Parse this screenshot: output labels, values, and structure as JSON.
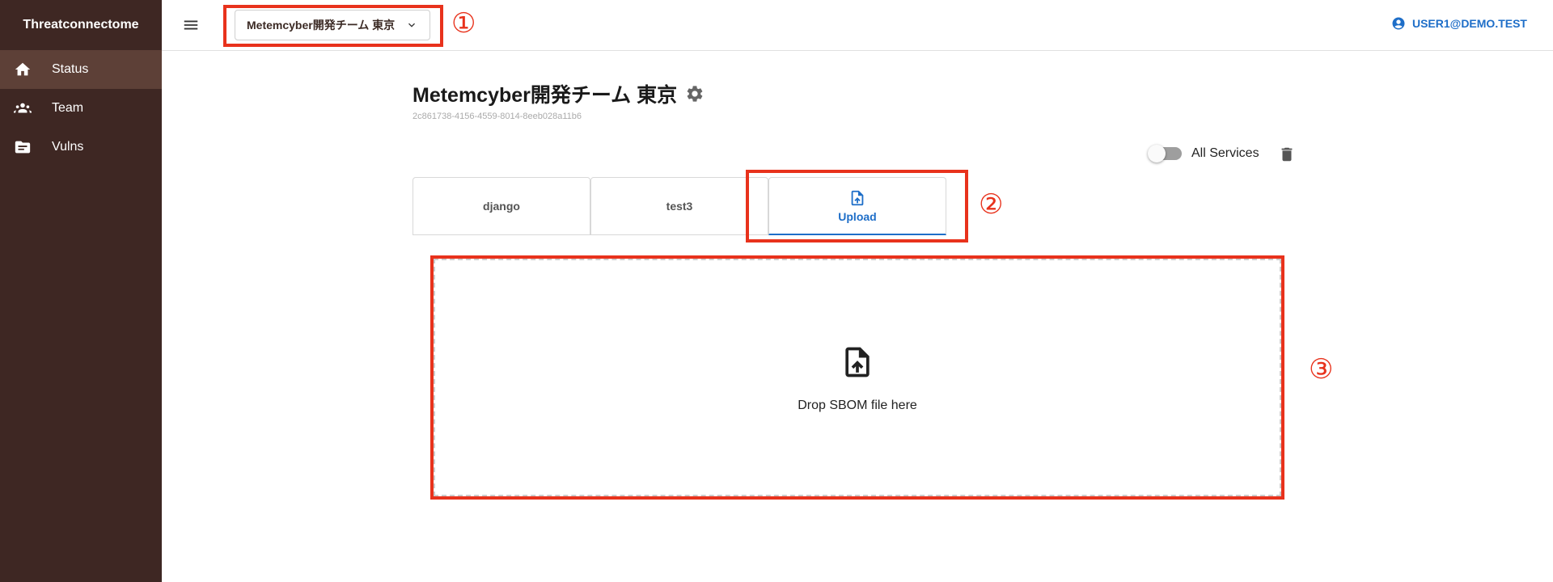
{
  "app": {
    "name": "Threatconnectome"
  },
  "sidebar": {
    "items": [
      {
        "label": "Status",
        "icon": "home-icon",
        "active": true
      },
      {
        "label": "Team",
        "icon": "groups-icon",
        "active": false
      },
      {
        "label": "Vulns",
        "icon": "topic-folder-icon",
        "active": false
      }
    ]
  },
  "header": {
    "team_selector": "Metemcyber開発チーム 東京",
    "user": "USER1@DEMO.TEST"
  },
  "main": {
    "title": "Metemcyber開発チーム 東京",
    "team_id": "2c861738-4156-4559-8014-8eeb028a11b6",
    "toggle_label": "All Services",
    "toggle_on": false,
    "tabs": [
      {
        "label": "django",
        "active": false
      },
      {
        "label": "test3",
        "active": false
      },
      {
        "label": "Upload",
        "active": true,
        "icon": "upload-file-icon"
      }
    ],
    "dropzone_text": "Drop SBOM file here"
  },
  "annotations": [
    "①",
    "②",
    "③"
  ],
  "colors": {
    "sidebar_bg": "#3e2723",
    "sidebar_active": "#5d4037",
    "accent": "#1e6ec8",
    "annotation": "#e8321c"
  }
}
